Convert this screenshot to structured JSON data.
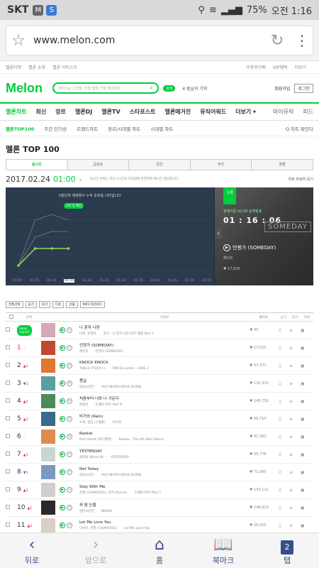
{
  "status": {
    "carrier": "SKT",
    "badge": "M",
    "battery": "75%",
    "time": "오전 1:16"
  },
  "browser": {
    "url": "www.melon.com"
  },
  "topnav": {
    "items": [
      "멜론티켓",
      "멜론 쇼핑",
      "멜론 아티스트"
    ],
    "right": [
      "이용권구매",
      "VIP혜택",
      "더보기"
    ]
  },
  "header": {
    "logo": "Melon",
    "search_placeholder": "원하시는 그라임, 추천 앨범 가장 좋은하다",
    "pill": "검색",
    "rank_inline": "4 봄날의 기억",
    "login": "회원가입",
    "login_btn": "로그인"
  },
  "gnb": {
    "items": [
      "멜론차트",
      "최신",
      "장르",
      "멜론DJ",
      "멜론TV",
      "스타포스트",
      "멜론매거진",
      "뮤직어워드",
      "더보기 ▾"
    ],
    "right": [
      "마이뮤직",
      "피드"
    ]
  },
  "subnav": {
    "items": [
      "멜론TOP100",
      "주간 인기상",
      "트렌드차트",
      "장르/시대별 차트",
      "시대별 차트"
    ],
    "right": "Q 차트 파인더"
  },
  "page_title": "멜론 TOP 100",
  "tabs": [
    "실시간",
    "급상승",
    "일간",
    "주간",
    "월별"
  ],
  "daterow": {
    "date": "2017.02.24",
    "time": "01:00",
    "note": "실시간 순위는 지난 1시간의 이용량을 반영하여 매시간 갱신됩니다",
    "right": "차트 자세히 보기"
  },
  "chart": {
    "notice": "5분단위 재생횟수 누적 순위를 나타냅니다",
    "badge": "1위 곡 확인",
    "xlabels": [
      "01:00",
      "01:05",
      "01:10",
      "01:15",
      "01:20",
      "01:25",
      "01:30",
      "01:35",
      "01:40",
      "01:45",
      "01:50",
      "01:55"
    ],
    "active_x": "01:15"
  },
  "chart_data": {
    "type": "line",
    "x": [
      "01:00",
      "01:05",
      "01:10",
      "01:15"
    ],
    "series": [
      {
        "values": [
          1,
          4,
          4,
          4
        ]
      },
      {
        "values": [
          1,
          6,
          7,
          7
        ]
      },
      {
        "values": [
          1,
          9,
          10,
          9
        ]
      }
    ],
    "ylim": [
      0,
      12
    ]
  },
  "now": {
    "rank": "1위",
    "ts": "현재기준 02:00 순위발표",
    "clock": "01 : 16 : 06",
    "album_text": "SOMEDAY",
    "title": "언젠가 (SOMEDAY)",
    "artist": "헤이즈",
    "likes": "♥ 17,025"
  },
  "actions": [
    "전체선택",
    "듣기",
    "담기",
    "다운",
    "선물",
    "MP3 다운로드"
  ],
  "columns": [
    "",
    "순위",
    "",
    "",
    "곡정보",
    "좋아요",
    "듣기",
    "담기",
    "뮤비"
  ],
  "rows": [
    {
      "rank": "",
      "change": "",
      "title": "나 혼자 나란",
      "artist": "나연, 유정연",
      "album": "살구 - 나 혼자 나란 OST 앨범 Part 1",
      "likes": "♥ 35",
      "color": "#d8a7b8",
      "ad": true
    },
    {
      "rank": "1",
      "change": "─",
      "title": "언젠가 (SOMEDAY)",
      "artist": "헤이즈",
      "album": "언젠가 (SOMEDAY)",
      "likes": "♥ 17,025",
      "color": "#c04a2f"
    },
    {
      "rank": "2",
      "change": "▲1",
      "title": "KNOCK KNOCK",
      "artist": "TWICE (트와이스)",
      "album": "TWICEcoaster : LANE 2",
      "likes": "♥ 57,377",
      "color": "#e07830"
    },
    {
      "rank": "3",
      "change": "▼1",
      "title": "봄날",
      "artist": "방탄소년단",
      "album": "YOU NEVER WALK ALONE",
      "likes": "♥ 135,333",
      "color": "#5aa0a0"
    },
    {
      "rank": "4",
      "change": "▲2",
      "title": "처음부터 너와 나 가둔다",
      "artist": "에일리",
      "album": "도깨비 OST Part 9",
      "likes": "♥ 145,730",
      "color": "#4d8a5a"
    },
    {
      "rank": "5",
      "change": "▲1",
      "title": "비가와 (Rain)",
      "artist": "수희, 김민 (스윗튠)",
      "album": "비가와",
      "likes": "♥ 66,710",
      "color": "#3a6a8a"
    },
    {
      "rank": "6",
      "change": "─",
      "title": "Rookie",
      "artist": "Red Velvet (레드벨벳)",
      "album": "Rookie - The 4th Mini Album",
      "likes": "♥ 42,363",
      "color": "#e08a50"
    },
    {
      "rank": "7",
      "change": "▲1",
      "title": "YESTERDAY",
      "artist": "블락비 (Block B)",
      "album": "YESTERDAY",
      "likes": "♥ 55,776",
      "color": "#c8d8d0"
    },
    {
      "rank": "8",
      "change": "▼1",
      "title": "Not Today",
      "artist": "방탄소년단",
      "album": "YOU NEVER WALK ALONE",
      "likes": "♥ 71,095",
      "color": "#7a9ac0"
    },
    {
      "rank": "9",
      "change": "▲1",
      "title": "Stay With Me",
      "artist": "찬열 (CHANYEOL), 펀치 (Punch)",
      "album": "도깨비 OST Part 1",
      "likes": "♥ 143,112",
      "color": "#cfcfcf"
    },
    {
      "rank": "10",
      "change": "▲1",
      "title": "피 땀 눈물",
      "artist": "방탄소년단",
      "album": "WINGS",
      "likes": "♥ 148,913",
      "color": "#2a2a2a"
    },
    {
      "rank": "11",
      "change": "▲1",
      "title": "Let Me Love You",
      "artist": "다비치, 찬열 (CHANYEOL)",
      "album": "Let Me Love You",
      "likes": "♥ 28,025",
      "color": "#d9d0c6"
    }
  ],
  "bottom": {
    "back": "뒤로",
    "forward": "앞으로",
    "home": "홈",
    "bookmark": "북마크",
    "tabs": "탭",
    "tab_count": "2"
  }
}
